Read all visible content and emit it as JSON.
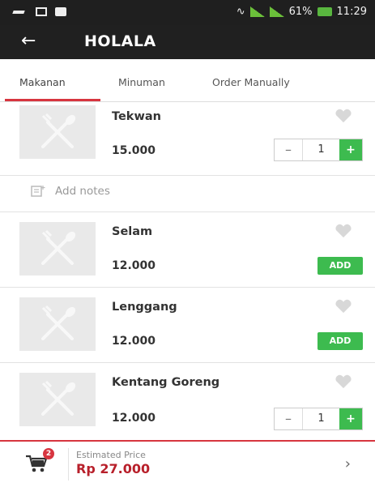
{
  "status_bar": {
    "battery": "61%",
    "time": "11:29"
  },
  "app_bar": {
    "title": "HOLALA"
  },
  "tabs": [
    {
      "label": "Makanan",
      "active": true
    },
    {
      "label": "Minuman",
      "active": false
    },
    {
      "label": "Order Manually",
      "active": false
    }
  ],
  "items": [
    {
      "name": "Tekwan",
      "price": "15.000",
      "qty": "1"
    },
    {
      "name": "Selam",
      "price": "12.000",
      "add_label": "ADD"
    },
    {
      "name": "Lenggang",
      "price": "12.000",
      "add_label": "ADD"
    },
    {
      "name": "Kentang Goreng",
      "price": "12.000",
      "qty": "1"
    }
  ],
  "notes": {
    "label": "Add notes"
  },
  "cart": {
    "badge": "2",
    "estimated_label": "Estimated Price",
    "estimated_value": "Rp 27.000"
  },
  "colors": {
    "accent_red": "#d7353f",
    "green": "#3dbb4f",
    "appbar": "#202020"
  }
}
